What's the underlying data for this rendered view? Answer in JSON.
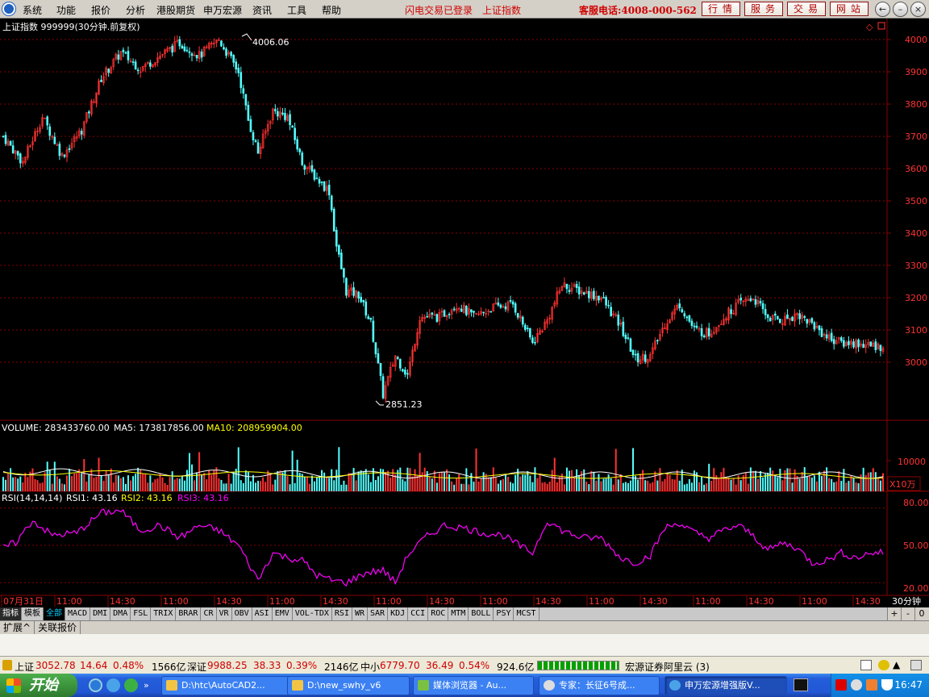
{
  "menu": {
    "items": [
      "系统",
      "功能",
      "报价",
      "分析",
      "港股期货",
      "申万宏源",
      "资讯",
      "工具",
      "帮助"
    ],
    "notice1": "闪电交易已登录",
    "notice2": "上证指数",
    "hotline": "客服电话:4008-000-562",
    "buttons": [
      "行情",
      "服务",
      "交易",
      "网站"
    ]
  },
  "chart_data": {
    "type": "candlestick",
    "title": "上证指数 999999(30分钟.前复权)",
    "price_axis": {
      "ticks": [
        3000,
        3100,
        3200,
        3300,
        3400,
        3500,
        3600,
        3700,
        3800,
        3900,
        4000
      ],
      "range": [
        2820,
        4030
      ]
    },
    "high_label": "4006.06",
    "low_label": "2851.23",
    "x_ticks": [
      "07月31日",
      "11:00",
      "14:30",
      "11:00",
      "14:30",
      "11:00",
      "14:30",
      "11:00",
      "14:30",
      "11:00",
      "14:30",
      "11:00",
      "14:30",
      "11:00",
      "14:30",
      "11:00",
      "14:30"
    ],
    "bar_period": "30分钟",
    "volume": {
      "label": "VOLUME: 283433760.00",
      "ma5_label": "MA5: 173817856.00",
      "ma10_label": "MA10: 208959904.00",
      "axis_tick": "10000",
      "unit": "X10万"
    },
    "rsi": {
      "label": "RSI(14,14,14)",
      "rsi1_label": "RSI1: 43.16",
      "rsi2_label": "RSI2: 43.16",
      "rsi3_label": "RSI3: 43.16",
      "ticks": [
        "80.00",
        "50.00",
        "20.00"
      ],
      "range": [
        15,
        85
      ]
    },
    "close_anchors": [
      [
        0,
        3700
      ],
      [
        8,
        3620
      ],
      [
        16,
        3760
      ],
      [
        24,
        3640
      ],
      [
        32,
        3720
      ],
      [
        40,
        3880
      ],
      [
        48,
        3960
      ],
      [
        56,
        3910
      ],
      [
        64,
        3950
      ],
      [
        72,
        3990
      ],
      [
        80,
        3950
      ],
      [
        88,
        4000
      ],
      [
        96,
        3900
      ],
      [
        100,
        3750
      ],
      [
        104,
        3650
      ],
      [
        110,
        3780
      ],
      [
        116,
        3760
      ],
      [
        122,
        3620
      ],
      [
        128,
        3570
      ],
      [
        133,
        3530
      ],
      [
        136,
        3360
      ],
      [
        140,
        3220
      ],
      [
        145,
        3210
      ],
      [
        150,
        3120
      ],
      [
        155,
        2900
      ],
      [
        160,
        3020
      ],
      [
        165,
        2960
      ],
      [
        170,
        3140
      ],
      [
        178,
        3140
      ],
      [
        185,
        3180
      ],
      [
        192,
        3140
      ],
      [
        200,
        3170
      ],
      [
        208,
        3180
      ],
      [
        216,
        3060
      ],
      [
        222,
        3130
      ],
      [
        228,
        3240
      ],
      [
        236,
        3220
      ],
      [
        244,
        3200
      ],
      [
        252,
        3110
      ],
      [
        258,
        3010
      ],
      [
        264,
        3020
      ],
      [
        270,
        3120
      ],
      [
        276,
        3180
      ],
      [
        282,
        3100
      ],
      [
        288,
        3090
      ],
      [
        294,
        3140
      ],
      [
        300,
        3180
      ],
      [
        306,
        3200
      ],
      [
        312,
        3140
      ],
      [
        318,
        3130
      ],
      [
        324,
        3150
      ],
      [
        330,
        3120
      ],
      [
        336,
        3080
      ],
      [
        342,
        3060
      ],
      [
        348,
        3060
      ],
      [
        354,
        3050
      ]
    ],
    "rsi_anchors": [
      [
        0,
        48
      ],
      [
        5,
        52
      ],
      [
        12,
        70
      ],
      [
        20,
        58
      ],
      [
        30,
        60
      ],
      [
        40,
        76
      ],
      [
        48,
        78
      ],
      [
        56,
        62
      ],
      [
        64,
        66
      ],
      [
        72,
        56
      ],
      [
        80,
        66
      ],
      [
        88,
        62
      ],
      [
        96,
        50
      ],
      [
        104,
        22
      ],
      [
        110,
        44
      ],
      [
        116,
        40
      ],
      [
        122,
        38
      ],
      [
        128,
        26
      ],
      [
        134,
        22
      ],
      [
        140,
        20
      ],
      [
        148,
        28
      ],
      [
        155,
        30
      ],
      [
        160,
        20
      ],
      [
        165,
        42
      ],
      [
        172,
        56
      ],
      [
        180,
        66
      ],
      [
        188,
        64
      ],
      [
        196,
        60
      ],
      [
        204,
        58
      ],
      [
        212,
        48
      ],
      [
        216,
        44
      ],
      [
        222,
        70
      ],
      [
        228,
        62
      ],
      [
        236,
        56
      ],
      [
        244,
        56
      ],
      [
        252,
        40
      ],
      [
        258,
        36
      ],
      [
        264,
        42
      ],
      [
        270,
        64
      ],
      [
        276,
        68
      ],
      [
        282,
        60
      ],
      [
        288,
        56
      ],
      [
        294,
        62
      ],
      [
        300,
        66
      ],
      [
        306,
        58
      ],
      [
        312,
        46
      ],
      [
        318,
        52
      ],
      [
        324,
        48
      ],
      [
        330,
        36
      ],
      [
        336,
        38
      ],
      [
        342,
        44
      ],
      [
        348,
        40
      ],
      [
        354,
        44
      ]
    ]
  },
  "indicator_tabs": [
    "指标",
    "模板",
    "全部",
    "MACD",
    "DMI",
    "DMA",
    "FSL",
    "TRIX",
    "BRAR",
    "CR",
    "VR",
    "OBV",
    "ASI",
    "EMV",
    "VOL-TDX",
    "RSI",
    "WR",
    "SAR",
    "KDJ",
    "CCI",
    "ROC",
    "MTM",
    "BOLL",
    "PSY",
    "MCST"
  ],
  "sub_tabs": [
    "扩展^",
    "关联报价"
  ],
  "right_ctl": [
    "+",
    "-",
    "0"
  ],
  "status": {
    "sh_name": "上证",
    "sh_value": "3052.78",
    "sh_change": "14.64",
    "sh_pct": "0.48%",
    "sh_amount": "1566亿",
    "sz_name": "深证",
    "sz_value": "9988.25",
    "sz_change": "38.33",
    "sz_pct": "0.39%",
    "sz_amount": "2146亿",
    "zx_name": "中小",
    "zx_value": "6779.70",
    "zx_change": "36.49",
    "zx_pct": "0.54%",
    "zx_amount": "924.6亿",
    "server": "宏源证券阿里云 (3)"
  },
  "taskbar": {
    "start": "开始",
    "tasks": [
      "D:\\htc\\AutoCAD2...",
      "D:\\new_swhy_v6",
      "媒体浏览器 - Au...",
      "专家：长征6号成...",
      "申万宏源增强版V..."
    ],
    "clock": "16:47"
  },
  "colors": {
    "up": "#ff3232",
    "down": "#54ffff",
    "grid": "#8a0000",
    "rsi": "#ff00ff",
    "ma5": "#ffffff",
    "ma10": "#ffff00"
  }
}
